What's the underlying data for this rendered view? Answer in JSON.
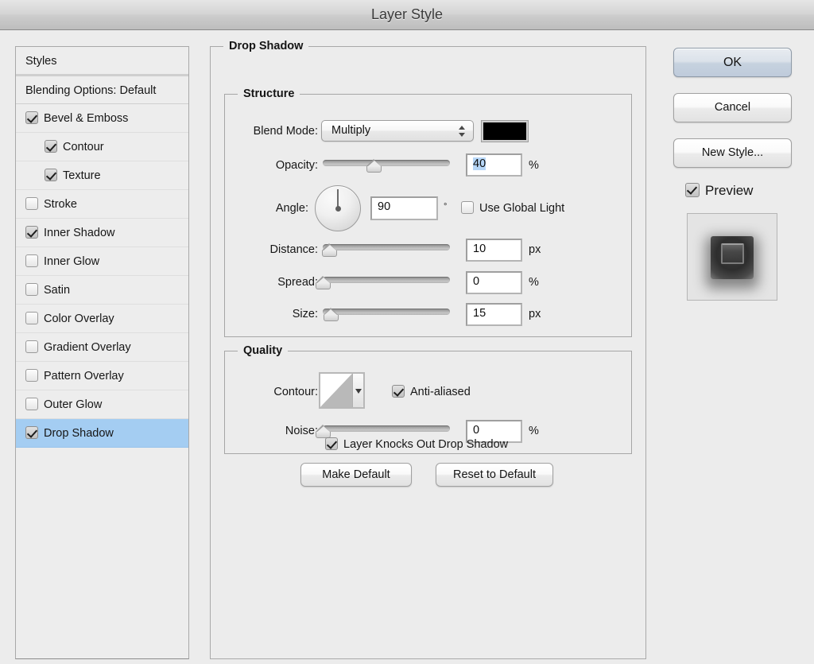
{
  "window": {
    "title": "Layer Style"
  },
  "styles_panel": {
    "header_label": "Styles",
    "blending_options_label": "Blending Options: Default",
    "effects": [
      {
        "label": "Bevel & Emboss",
        "checked": true,
        "indent": false,
        "selected": false
      },
      {
        "label": "Contour",
        "checked": true,
        "indent": true,
        "selected": false
      },
      {
        "label": "Texture",
        "checked": true,
        "indent": true,
        "selected": false
      },
      {
        "label": "Stroke",
        "checked": false,
        "indent": false,
        "selected": false
      },
      {
        "label": "Inner Shadow",
        "checked": true,
        "indent": false,
        "selected": false
      },
      {
        "label": "Inner Glow",
        "checked": false,
        "indent": false,
        "selected": false
      },
      {
        "label": "Satin",
        "checked": false,
        "indent": false,
        "selected": false
      },
      {
        "label": "Color Overlay",
        "checked": false,
        "indent": false,
        "selected": false
      },
      {
        "label": "Gradient Overlay",
        "checked": false,
        "indent": false,
        "selected": false
      },
      {
        "label": "Pattern Overlay",
        "checked": false,
        "indent": false,
        "selected": false
      },
      {
        "label": "Outer Glow",
        "checked": false,
        "indent": false,
        "selected": false
      },
      {
        "label": "Drop Shadow",
        "checked": true,
        "indent": false,
        "selected": true
      }
    ],
    "selection_color": "#a4cdf2"
  },
  "drop_shadow": {
    "panel_title": "Drop Shadow",
    "structure": {
      "title": "Structure",
      "blend_mode": {
        "label": "Blend Mode:",
        "value": "Multiply",
        "color_swatch": "#000000"
      },
      "opacity": {
        "label": "Opacity:",
        "value": "40",
        "unit": "%",
        "slider_percent": 40,
        "selected": true
      },
      "angle": {
        "label": "Angle:",
        "value": "90",
        "unit": "°",
        "dial_degrees": 90,
        "use_global_light": {
          "label": "Use Global Light",
          "checked": false
        }
      },
      "distance": {
        "label": "Distance:",
        "value": "10",
        "unit": "px",
        "slider_percent": 5
      },
      "spread": {
        "label": "Spread:",
        "value": "0",
        "unit": "%",
        "slider_percent": 0
      },
      "size": {
        "label": "Size:",
        "value": "15",
        "unit": "px",
        "slider_percent": 5
      }
    },
    "quality": {
      "title": "Quality",
      "contour": {
        "label": "Contour:",
        "preset": "linear"
      },
      "anti_aliased": {
        "label": "Anti-aliased",
        "checked": true
      },
      "noise": {
        "label": "Noise:",
        "value": "0",
        "unit": "%",
        "slider_percent": 0
      }
    },
    "knockout": {
      "label": "Layer Knocks Out Drop Shadow",
      "checked": true
    },
    "make_default_label": "Make Default",
    "reset_to_default_label": "Reset to Default"
  },
  "actions": {
    "ok_label": "OK",
    "cancel_label": "Cancel",
    "new_style_label": "New Style...",
    "preview": {
      "label": "Preview",
      "checked": true
    }
  }
}
